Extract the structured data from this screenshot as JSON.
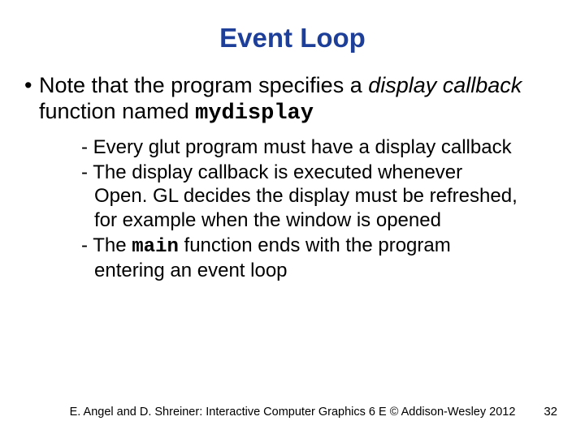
{
  "title": "Event Loop",
  "main_bullet": {
    "pre": "Note that the program specifies a ",
    "italic": "display callback",
    "mid": " function named ",
    "code": "mydisplay"
  },
  "sub": {
    "s1": "Every glut program must have a display callback",
    "s2a": "The display callback is executed whenever Open. GL decides the display must be refreshed, for example when the window is opened",
    "s3a": "The ",
    "s3b": "main",
    "s3c": " function ends with the program entering an event loop"
  },
  "footer": "E. Angel and D. Shreiner: Interactive Computer Graphics 6 E © Addison-Wesley 2012",
  "page": "32"
}
